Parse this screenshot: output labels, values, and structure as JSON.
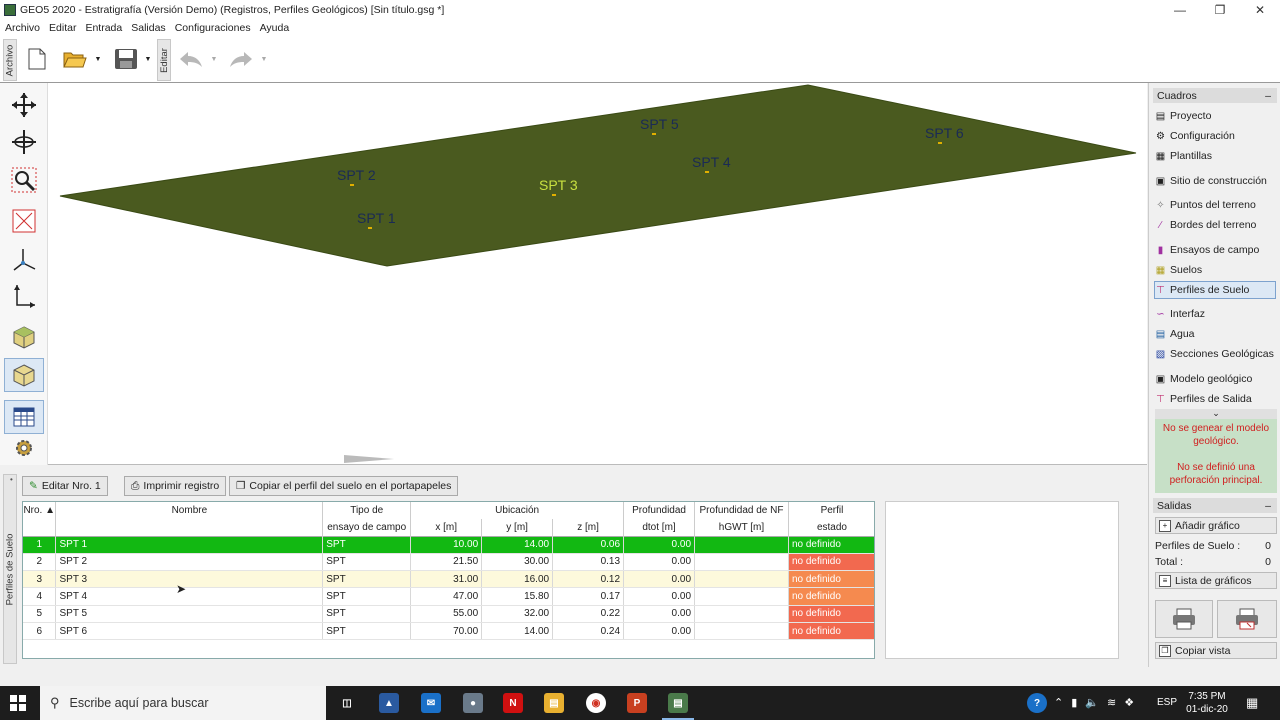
{
  "window": {
    "title": "GEO5 2020 - Estratigrafía (Versión Demo) (Registros, Perfiles Geológicos) [Sin título.gsg *]"
  },
  "menu": [
    "Archivo",
    "Editar",
    "Entrada",
    "Salidas",
    "Configuraciones",
    "Ayuda"
  ],
  "toolbar": {
    "archivo_tab": "Archivo",
    "editar_tab": "Editar"
  },
  "viewport": {
    "labels": [
      "SPT 1",
      "SPT 2",
      "SPT 3",
      "SPT 4",
      "SPT 5",
      "SPT 6"
    ],
    "highlighted": "SPT 3",
    "terrain_color": "#4a5a1f"
  },
  "bottom": {
    "side_label": "Perfiles de Suelo",
    "buttons": {
      "edit": "Editar Nro. 1",
      "print": "Imprimir registro",
      "copy": "Copiar el perfil del suelo en el portapapeles"
    },
    "table": {
      "header1": {
        "nro": "Nro.",
        "nombre": "Nombre",
        "tipo": "Tipo de",
        "ubicacion": "Ubicación",
        "prof": "Profundidad",
        "prof_nf": "Profundidad de NF",
        "perfil": "Perfil"
      },
      "header2": {
        "tipo": "ensayo de campo",
        "x": "x [m]",
        "y": "y [m]",
        "z": "z [m]",
        "d": "dtot [m]",
        "h": "hGWT [m]",
        "estado": "estado"
      },
      "rows": [
        {
          "nro": "1",
          "nombre": "SPT 1",
          "tipo": "SPT",
          "x": "10.00",
          "y": "14.00",
          "z": "0.06",
          "d": "0.00",
          "h": "",
          "estado": "no definido"
        },
        {
          "nro": "2",
          "nombre": "SPT 2",
          "tipo": "SPT",
          "x": "21.50",
          "y": "30.00",
          "z": "0.13",
          "d": "0.00",
          "h": "",
          "estado": "no definido"
        },
        {
          "nro": "3",
          "nombre": "SPT 3",
          "tipo": "SPT",
          "x": "31.00",
          "y": "16.00",
          "z": "0.12",
          "d": "0.00",
          "h": "",
          "estado": "no definido"
        },
        {
          "nro": "4",
          "nombre": "SPT 4",
          "tipo": "SPT",
          "x": "47.00",
          "y": "15.80",
          "z": "0.17",
          "d": "0.00",
          "h": "",
          "estado": "no definido"
        },
        {
          "nro": "5",
          "nombre": "SPT 5",
          "tipo": "SPT",
          "x": "55.00",
          "y": "32.00",
          "z": "0.22",
          "d": "0.00",
          "h": "",
          "estado": "no definido"
        },
        {
          "nro": "6",
          "nombre": "SPT 6",
          "tipo": "SPT",
          "x": "70.00",
          "y": "14.00",
          "z": "0.24",
          "d": "0.00",
          "h": "",
          "estado": "no definido"
        }
      ]
    }
  },
  "right": {
    "cuadros_title": "Cuadros",
    "items": [
      "Proyecto",
      "Configuración",
      "Plantillas",
      "Sitio de construcción",
      "Puntos del terreno",
      "Bordes del terreno",
      "Ensayos de campo",
      "Suelos",
      "Perfiles de Suelo",
      "Interfaz",
      "Agua",
      "Secciones Geológicas",
      "Modelo geológico",
      "Perfiles de Salida"
    ],
    "selected": "Perfiles de Suelo",
    "error_1": "No se genear el modelo geológico.",
    "error_2": "No se definió una perforación principal.",
    "salidas_title": "Salidas",
    "add_graph": "Añadir gráfico",
    "perfiles_label": "Perfiles de Suelo :",
    "perfiles_count": "0",
    "total_label": "Total :",
    "total_count": "0",
    "graph_list": "Lista de gráficos",
    "copy_view": "Copiar vista"
  },
  "taskbar": {
    "search_placeholder": "Escribe aquí para buscar",
    "lang": "ESP",
    "time": "7:35 PM",
    "date": "01-dic-20"
  }
}
